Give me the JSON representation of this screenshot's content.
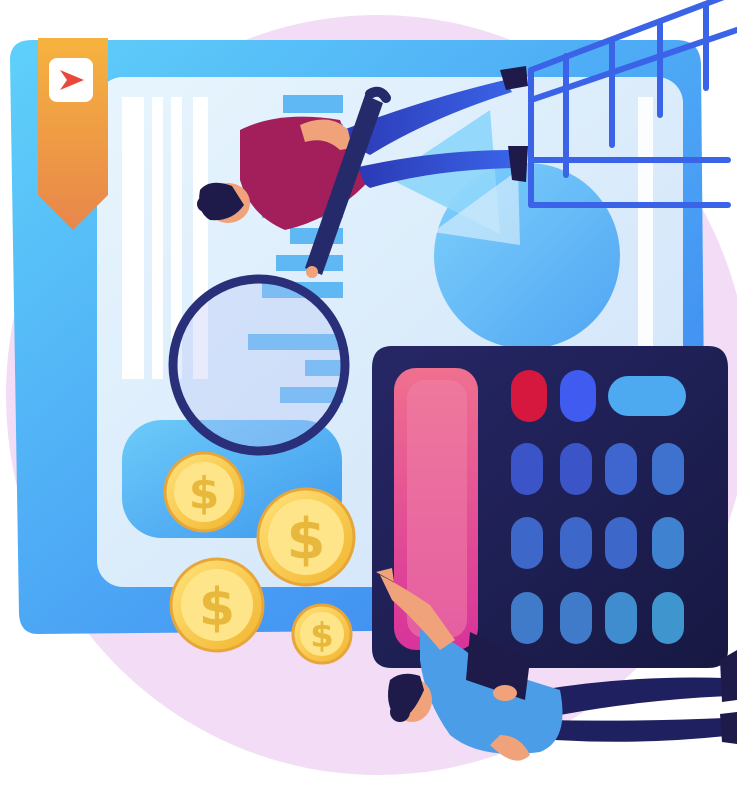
{
  "illustration": {
    "alt": "",
    "icons": {
      "bookmark": "play-arrow-icon",
      "magnifier": "magnifying-glass-icon",
      "calculator": "calculator-icon",
      "coin": "dollar-coin-icon",
      "ladder": "ladder-icon",
      "pie": "pie-chart-icon",
      "bars": "bar-chart-icon"
    },
    "coin_symbol": "$",
    "colors": {
      "backdrop_circle": "#F2D9F5",
      "panel_blue": "#4FB4F7",
      "panel_inner": "#D8ECFB",
      "bookmark_orange": "#EFA244",
      "arrow_red": "#E8473A",
      "ladder_blue": "#3A63E8",
      "calculator_navy": "#1F2057",
      "calculator_pink": "#E84E8A",
      "key_red": "#D6183F",
      "key_blue": "#3F5BF0",
      "key_cyan": "#4DA9F0",
      "coin_gold": "#F6D04D",
      "person_shirt": "#A21F5C",
      "person_pants": "#2B39B8",
      "skin": "#F0A27A",
      "hair": "#1E1A4A"
    }
  }
}
